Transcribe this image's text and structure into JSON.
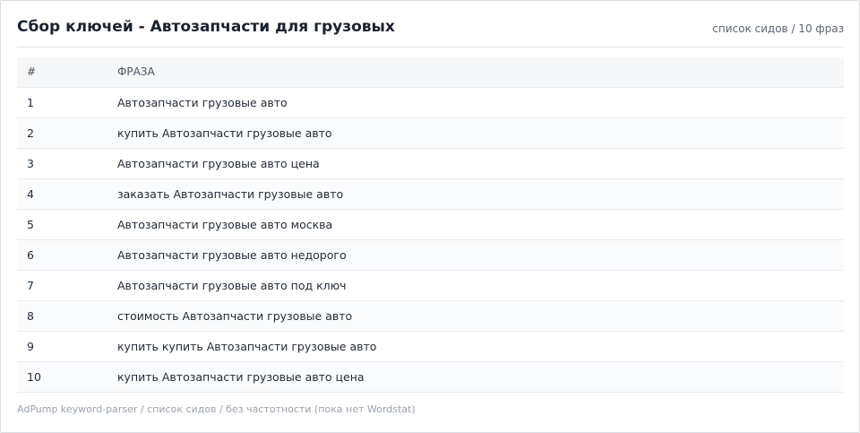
{
  "header": {
    "title": "Сбор ключей - Автозапчасти для грузовых",
    "meta": "список сидов / 10 фраз"
  },
  "table": {
    "columns": [
      "#",
      "ФРАЗА"
    ],
    "rows": [
      {
        "num": "1",
        "phrase": "Автозапчасти грузовые авто"
      },
      {
        "num": "2",
        "phrase": "купить Автозапчасти грузовые авто"
      },
      {
        "num": "3",
        "phrase": "Автозапчасти грузовые авто цена"
      },
      {
        "num": "4",
        "phrase": "заказать Автозапчасти грузовые авто"
      },
      {
        "num": "5",
        "phrase": "Автозапчасти грузовые авто москва"
      },
      {
        "num": "6",
        "phrase": "Автозапчасти грузовые авто недорого"
      },
      {
        "num": "7",
        "phrase": "Автозапчасти грузовые авто под ключ"
      },
      {
        "num": "8",
        "phrase": "стоимость Автозапчасти грузовые авто"
      },
      {
        "num": "9",
        "phrase": "купить купить Автозапчасти грузовые авто"
      },
      {
        "num": "10",
        "phrase": "купить Автозапчасти грузовые авто цена"
      }
    ]
  },
  "footer": {
    "text": "AdPump keyword-parser / список сидов / без частотности (пока нет Wordstat)"
  }
}
